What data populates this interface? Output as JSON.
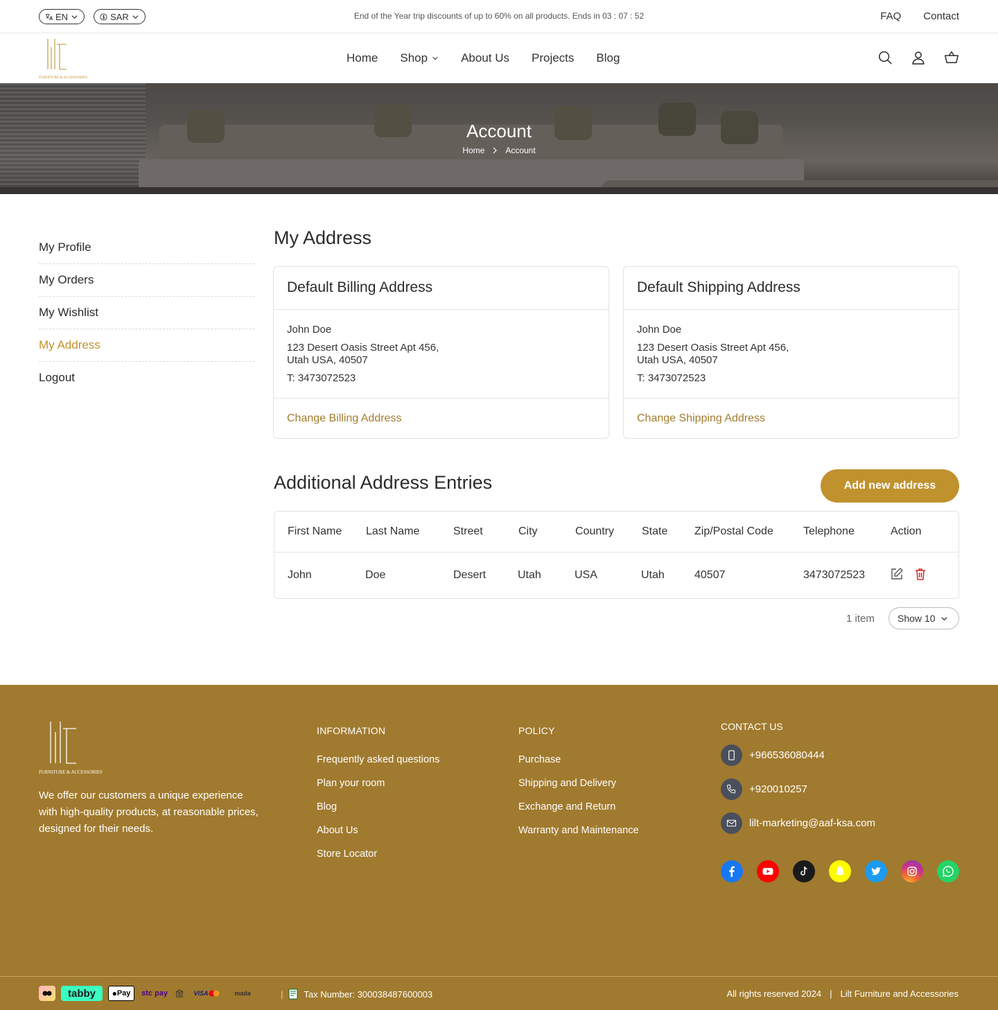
{
  "topbar": {
    "language": "EN",
    "currency": "SAR",
    "promo": "End of the Year trip discounts of up to 60% on all products. Ends in 03 : 07 : 52",
    "links": [
      "FAQ",
      "Contact"
    ]
  },
  "brand": {
    "logo_text": "lilt",
    "logo_sub": "FURNITURE & ACCESSORIES",
    "accent": "#c0922e",
    "footer_bg": "#a07a2e"
  },
  "nav": {
    "items": [
      "Home",
      "Shop",
      "About Us",
      "Projects",
      "Blog"
    ],
    "icons": [
      "search-icon",
      "user-icon",
      "cart-icon"
    ]
  },
  "hero": {
    "title": "Account",
    "breadcrumb": [
      "Home",
      "Account"
    ]
  },
  "sidebar": {
    "items": [
      "My Profile",
      "My Orders",
      "My Wishlist",
      "My Address",
      "Logout"
    ],
    "active": "My Address"
  },
  "main": {
    "title": "My Address",
    "billing": {
      "title": "Default Billing Address",
      "name": "John Doe",
      "line1": "123 Desert Oasis Street Apt 456,",
      "line2": "Utah USA, 40507",
      "tel": "T: 3473072523",
      "link": "Change Billing Address"
    },
    "shipping": {
      "title": "Default Shipping Address",
      "name": "John Doe",
      "line1": "123 Desert Oasis Street Apt 456,",
      "line2": "Utah USA, 40507",
      "tel": "T: 3473072523",
      "link": "Change Shipping Address"
    },
    "additional_title": "Additional Address Entries",
    "add_button": "Add new address",
    "table": {
      "columns": [
        "First Name",
        "Last Name",
        "Street",
        "City",
        "Country",
        "State",
        "Zip/Postal Code",
        "Telephone",
        "Action"
      ],
      "rows": [
        [
          "John",
          "Doe",
          "Desert",
          "Utah",
          "USA",
          "Utah",
          "40507",
          "3473072523"
        ]
      ]
    },
    "pager": {
      "count": "1 item",
      "show": "Show 10"
    }
  },
  "footer": {
    "about": "We offer our customers a unique experience with high-quality products, at reasonable prices, designed for their needs.",
    "information": {
      "title": "INFORMATION",
      "links": [
        "Frequently asked questions",
        "Plan your room",
        "Blog",
        "About Us",
        "Store Locator"
      ]
    },
    "policy": {
      "title": "POLICY",
      "links": [
        "Purchase",
        "Shipping and Delivery",
        "Exchange and Return",
        "Warranty and Maintenance"
      ]
    },
    "contact": {
      "title": "CONTACT US",
      "mobile": "+966536080444",
      "phone": "+920010257",
      "email": "lilt-marketing@aaf-ksa.com"
    },
    "socials": [
      "facebook-icon",
      "youtube-icon",
      "tiktok-icon",
      "snapchat-icon",
      "twitter-icon",
      "instagram-icon",
      "whatsapp-icon"
    ],
    "payments": [
      "tabby",
      "Pay",
      "stc pay",
      "VISA",
      "mada"
    ],
    "tax": "Tax Number: 300038487600003",
    "rights": "All rights reserved 2024",
    "company": "Lilt Furniture and Accessories"
  }
}
